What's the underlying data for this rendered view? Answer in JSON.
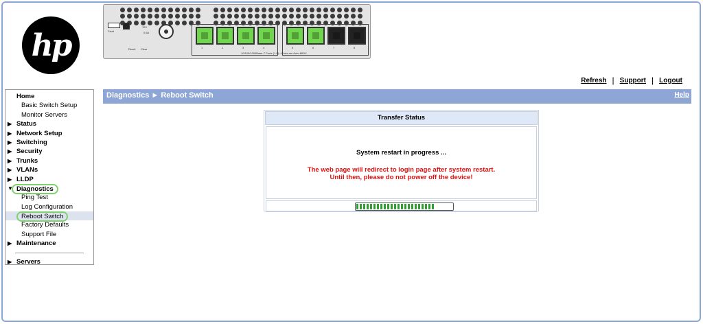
{
  "header": {
    "logo_text": "hp",
    "links": [
      "Refresh",
      "Support",
      "Logout"
    ]
  },
  "device_panel": {
    "port_numbers": [
      "1",
      "2",
      "3",
      "4",
      "5",
      "6",
      "7",
      "8"
    ],
    "port_note": "10/100/1000Base-T Ports (1-8)—Ports are Auto-MDIX",
    "labels": {
      "fault": "Fault",
      "reset": "Reset",
      "clear": "Clear",
      "power": "12V",
      "current": "0.6A"
    }
  },
  "sidebar": {
    "items": [
      {
        "label": "Home",
        "type": "home"
      },
      {
        "label": "Basic Switch Setup",
        "type": "sub"
      },
      {
        "label": "Monitor Servers",
        "type": "sub"
      },
      {
        "label": "Status",
        "type": "top",
        "arrow": "▶"
      },
      {
        "label": "Network Setup",
        "type": "top",
        "arrow": "▶"
      },
      {
        "label": "Switching",
        "type": "top",
        "arrow": "▶"
      },
      {
        "label": "Security",
        "type": "top",
        "arrow": "▶"
      },
      {
        "label": "Trunks",
        "type": "top",
        "arrow": "▶"
      },
      {
        "label": "VLANs",
        "type": "top",
        "arrow": "▶"
      },
      {
        "label": "LLDP",
        "type": "top",
        "arrow": "▶"
      },
      {
        "label": "Diagnostics",
        "type": "top",
        "arrow": "▼"
      },
      {
        "label": "Ping Test",
        "type": "sub"
      },
      {
        "label": "Log Configuration",
        "type": "sub"
      },
      {
        "label": "Reboot Switch",
        "type": "sub"
      },
      {
        "label": "Factory Defaults",
        "type": "sub"
      },
      {
        "label": "Support File",
        "type": "sub"
      },
      {
        "label": "Maintenance",
        "type": "top",
        "arrow": "▶"
      },
      {
        "label": "Servers",
        "type": "top",
        "arrow": "▶"
      }
    ],
    "selected": "Reboot Switch"
  },
  "main": {
    "title": "Diagnostics ► Reboot Switch",
    "help": "Help",
    "transfer": {
      "header": "Transfer Status",
      "message": "System restart in progress ...",
      "warning_line1": "The web page will redirect to login page after system restart.",
      "warning_line2": "Until then, please do not power off the device!",
      "progress_segments": 23
    }
  },
  "colors": {
    "title_bar": "#8ea6d6",
    "highlight": "#7dd36a",
    "progress": "#2fa02f",
    "warning": "#e01010",
    "port_active": "#6fd64d"
  }
}
